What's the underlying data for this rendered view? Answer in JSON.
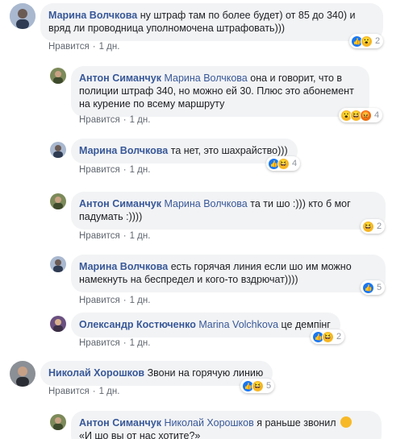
{
  "comments": [
    {
      "name": "Марина Волчкова",
      "mention": "",
      "text": "ну штраф там по более будет) от 85 до 340) и вряд ли проводница уполномочена штрафовать)))",
      "like": "Нравится",
      "time": "1 дн.",
      "reactions": [
        "like",
        "wow"
      ],
      "count": "2"
    },
    {
      "name": "Антон Симанчук",
      "mention": "Марина Волчкова",
      "text": "она и говорит, что в полиции штраф 340, но можно ей 30. Плюс это абонемент на курение по всему маршруту",
      "like": "Нравится",
      "time": "1 дн.",
      "reactions": [
        "wow",
        "haha",
        "angry"
      ],
      "count": "4"
    },
    {
      "name": "Марина Волчкова",
      "mention": "",
      "text": "та нет, это шахрайство)))",
      "like": "Нравится",
      "time": "1 дн.",
      "reactions": [
        "like",
        "haha"
      ],
      "count": "4"
    },
    {
      "name": "Антон Симанчук",
      "mention": "Марина Волчкова",
      "text": "та ти шо :))) кто б мог падумать :))))",
      "like": "Нравится",
      "time": "1 дн.",
      "reactions": [
        "haha"
      ],
      "count": "2"
    },
    {
      "name": "Марина Волчкова",
      "mention": "",
      "text": "есть горячая линия если шо им можно намекнуть на беспредел и кого-то вздрючат))))",
      "like": "Нравится",
      "time": "1 дн.",
      "reactions": [
        "like"
      ],
      "count": "5"
    },
    {
      "name": "Олександр Костюченко",
      "mention": "Marina Volchkova",
      "text": "це демпінг",
      "like": "Нравится",
      "time": "1 дн.",
      "reactions": [
        "like",
        "haha"
      ],
      "count": "2"
    },
    {
      "name": "Николай Хорошков",
      "mention": "",
      "text": "Звони на горячую линию",
      "like": "Нравится",
      "time": "1 дн.",
      "reactions": [
        "like",
        "haha"
      ],
      "count": "5"
    },
    {
      "name": "Антон Симанчук",
      "mention": "Николай Хорошков",
      "text": "я раньше звонил",
      "text2": "«И шо вы от нас хотите?»",
      "like": "",
      "time": "",
      "reactions": [],
      "count": ""
    }
  ]
}
